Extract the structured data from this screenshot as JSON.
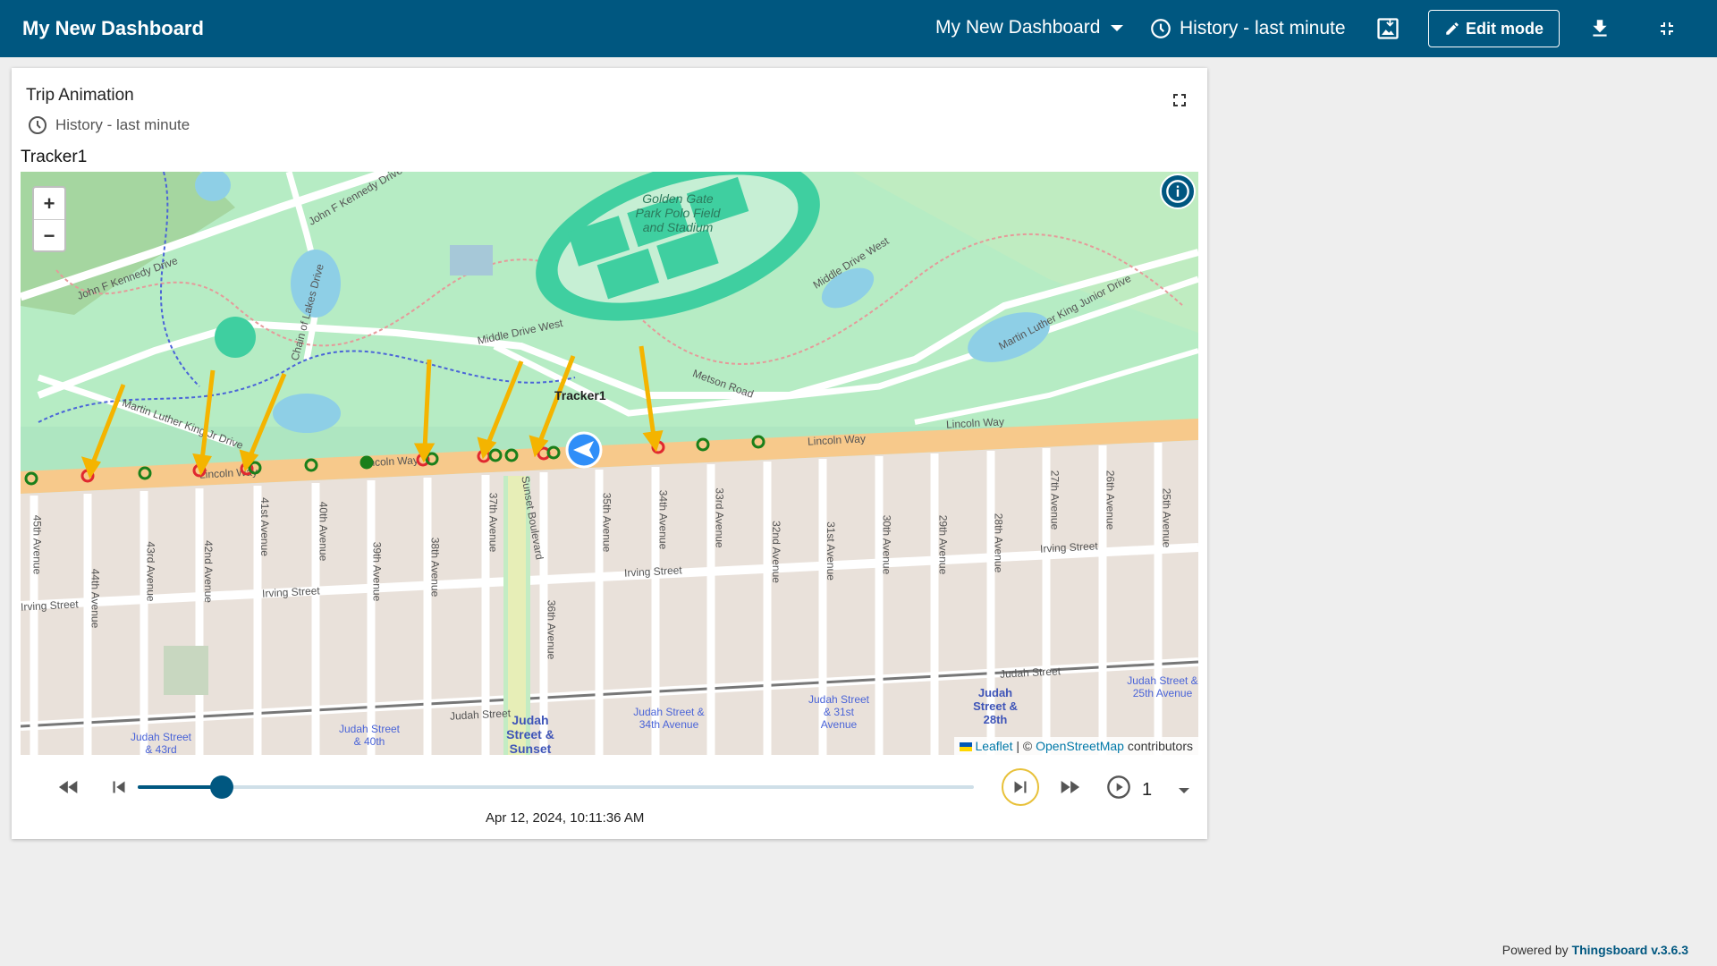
{
  "header": {
    "title": "My New Dashboard",
    "dashboard_select": "My New Dashboard",
    "history": "History - last minute",
    "edit_mode": "Edit mode"
  },
  "widget": {
    "title": "Trip Animation",
    "subtitle": "History - last minute",
    "tracker_label": "Tracker1"
  },
  "map": {
    "marker_label": "Tracker1",
    "zoom_in": "+",
    "zoom_out": "−",
    "attribution_leaflet": "Leaflet",
    "attribution_sep": "| ©",
    "attribution_osm": "OpenStreetMap",
    "attribution_suffix": "contributors",
    "labels": {
      "jfk1": "John F Kennedy Drive",
      "jfk2": "John F Kennedy Drive",
      "chain": "Chain of Lakes Drive",
      "mlk": "Martin Luther King Jr Drive",
      "mlk2": "Martin Luther King Junior Drive",
      "middle": "Middle Drive West",
      "middle2": "Middle Drive West",
      "metson": "Metson Road",
      "polo": "Golden Gate Park Polo Field and Stadium",
      "lincoln1": "Lincoln Way",
      "lincoln2": "Lincoln Way",
      "lincoln3": "Lincoln Way",
      "lincoln4": "Lincoln Way",
      "irving1": "Irving Street",
      "irving2": "Irving Street",
      "irving3": "Irving Street",
      "judah_st": "Judah Street",
      "judah_st2": "Judah Street",
      "sunset": "Sunset Boulevard",
      "stop_40th": "Judah Street & 40th",
      "stop_43rd": "Judah Street & 43rd",
      "stop_sunset": "Judah Street & Sunset",
      "stop_34th": "Judah Street & 34th Avenue",
      "stop_31st": "Judah Street & 31st Avenue",
      "stop_28th": "Judah Street & 28th",
      "stop_25th": "Judah Street & 25th Avenue",
      "ave_45": "45th Avenue",
      "ave_44": "44th Avenue",
      "ave_43": "43rd Avenue",
      "ave_42": "42nd Avenue",
      "ave_41": "41st Avenue",
      "ave_40": "40th Avenue",
      "ave_39": "39th Avenue",
      "ave_38": "38th Avenue",
      "ave_37": "37th Avenue",
      "ave_36": "36th Avenue",
      "ave_35": "35th Avenue",
      "ave_34": "34th Avenue",
      "ave_33": "33rd Avenue",
      "ave_32": "32nd Avenue",
      "ave_31": "31st Avenue",
      "ave_30": "30th Avenue",
      "ave_29": "29th Avenue",
      "ave_28": "28th Avenue",
      "ave_27": "27th Avenue",
      "ave_26": "26th Avenue",
      "ave_25": "25th Avenue"
    }
  },
  "player": {
    "timestamp": "Apr 12, 2024, 10:11:36 AM",
    "speed": "1",
    "progress": 0.1
  },
  "footer": {
    "prefix": "Powered by",
    "brand": "Thingsboard v.3.6.3"
  },
  "colors": {
    "primary": "#005780",
    "arrow": "#f4b400",
    "point_green": "#1a7f1a",
    "point_red": "#e0282f",
    "road": "#f7c98b"
  }
}
